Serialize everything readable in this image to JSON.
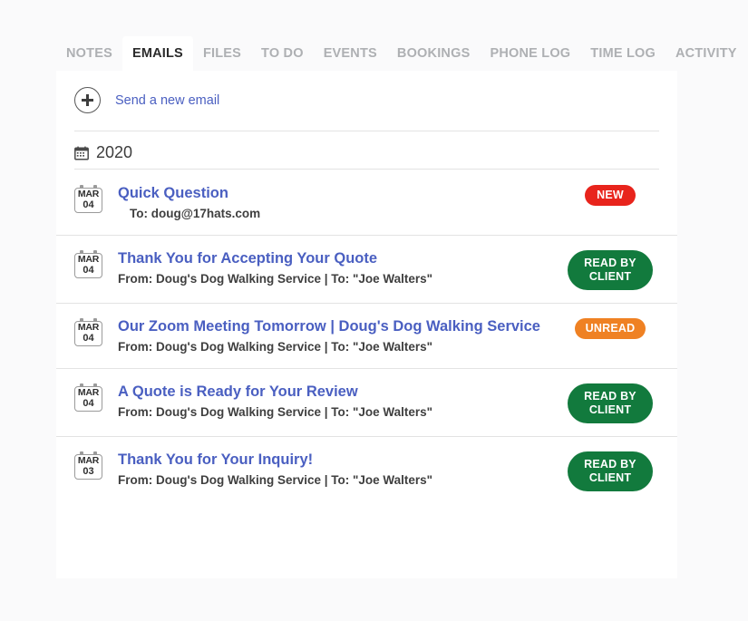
{
  "tabs": [
    {
      "label": "NOTES",
      "active": false
    },
    {
      "label": "EMAILS",
      "active": true
    },
    {
      "label": "FILES",
      "active": false
    },
    {
      "label": "TO DO",
      "active": false
    },
    {
      "label": "EVENTS",
      "active": false
    },
    {
      "label": "BOOKINGS",
      "active": false
    },
    {
      "label": "PHONE LOG",
      "active": false
    },
    {
      "label": "TIME LOG",
      "active": false
    },
    {
      "label": "ACTIVITY",
      "active": false
    }
  ],
  "compose": {
    "icon": "plus-circle-icon",
    "label": "Send a new email"
  },
  "group": {
    "icon": "calendar-icon",
    "year": "2020"
  },
  "emails": [
    {
      "month": "MAR",
      "day": "04",
      "subject": "Quick Question",
      "meta": "To: doug@17hats.com",
      "meta_indent": true,
      "badge": {
        "text": "NEW",
        "kind": "new",
        "color": "#e8241c"
      }
    },
    {
      "month": "MAR",
      "day": "04",
      "subject": "Thank You for Accepting Your Quote",
      "meta": "From: Doug's Dog Walking Service | To: \"Joe Walters\"",
      "meta_indent": false,
      "badge": {
        "text": "READ BY\nCLIENT",
        "kind": "read",
        "color": "#127a3d"
      }
    },
    {
      "month": "MAR",
      "day": "04",
      "subject": "Our Zoom Meeting Tomorrow | Doug's Dog Walking Service",
      "meta": "From: Doug's Dog Walking Service | To: \"Joe Walters\"",
      "meta_indent": false,
      "badge": {
        "text": "UNREAD",
        "kind": "unread",
        "color": "#ef8123"
      }
    },
    {
      "month": "MAR",
      "day": "04",
      "subject": "A Quote is Ready for Your Review",
      "meta": "From: Doug's Dog Walking Service | To: \"Joe Walters\"",
      "meta_indent": false,
      "badge": {
        "text": "READ BY\nCLIENT",
        "kind": "read",
        "color": "#127a3d"
      }
    },
    {
      "month": "MAR",
      "day": "03",
      "subject": "Thank You for Your Inquiry!",
      "meta": "From: Doug's Dog Walking Service | To: \"Joe Walters\"",
      "meta_indent": false,
      "badge": {
        "text": "READ BY\nCLIENT",
        "kind": "read",
        "color": "#127a3d"
      }
    }
  ],
  "colors": {
    "link": "#4a5fc1",
    "page_background": "#fafafb",
    "panel_background": "#ffffff",
    "divider": "#e3e3e3",
    "tab_inactive": "#aeb0b3",
    "tab_active": "#2b2b2b"
  }
}
